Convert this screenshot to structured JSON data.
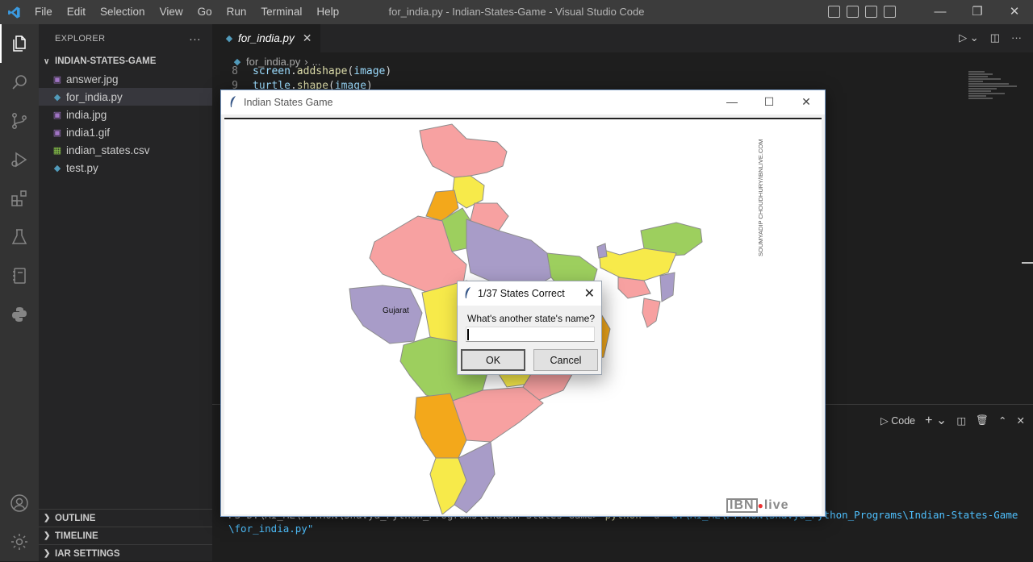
{
  "window": {
    "title": "for_india.py - Indian-States-Game - Visual Studio Code",
    "menu": [
      "File",
      "Edit",
      "Selection",
      "View",
      "Go",
      "Run",
      "Terminal",
      "Help"
    ]
  },
  "sidebar": {
    "header": "EXPLORER",
    "folder": "INDIAN-STATES-GAME",
    "files": [
      {
        "name": "answer.jpg",
        "icon": "image-file-icon",
        "color": "#a074c4"
      },
      {
        "name": "for_india.py",
        "icon": "python-file-icon",
        "color": "#519aba",
        "selected": true
      },
      {
        "name": "india.jpg",
        "icon": "image-file-icon",
        "color": "#a074c4"
      },
      {
        "name": "india1.gif",
        "icon": "image-file-icon",
        "color": "#a074c4"
      },
      {
        "name": "indian_states.csv",
        "icon": "csv-file-icon",
        "color": "#89c64a"
      },
      {
        "name": "test.py",
        "icon": "python-file-icon",
        "color": "#519aba"
      }
    ],
    "sections": [
      "OUTLINE",
      "TIMELINE",
      "IAR SETTINGS"
    ]
  },
  "editor": {
    "tab": "for_india.py",
    "breadcrumb_file": "for_india.py",
    "breadcrumb_rest": "...",
    "lines": [
      {
        "num": "8",
        "obj": "screen",
        "fn": "addshape",
        "arg": "image"
      },
      {
        "num": "9",
        "obj": "turtle",
        "fn": "shape",
        "arg": "image"
      }
    ]
  },
  "panel": {
    "profile_label": "Code",
    "terminal_prompt": "PS D:\\AI_ML\\PYTHON\\Shavya_Python_Programs\\Indian-States-Game>",
    "terminal_cmd": "python",
    "terminal_flag": "-u",
    "terminal_path": "\"d:\\AI_ML\\PYTHON\\Shavya_Python_Programs\\Indian-States-Game\\for_india.py\""
  },
  "game_window": {
    "title": "Indian States Game",
    "map_label": "Gujarat",
    "watermark": "SOUMYADIP CHOUDHURY/IBNLIVE.COM",
    "logo": "IBNLive"
  },
  "dialog": {
    "title": "1/37 States Correct",
    "prompt": "What's another state's name?",
    "input_value": "",
    "ok_label": "OK",
    "cancel_label": "Cancel"
  },
  "colors": {
    "map_pink": "#f7a1a1",
    "map_yellow": "#f7ea4a",
    "map_green": "#9dcf5e",
    "map_purple": "#a89cc8",
    "map_orange": "#f3a81b"
  }
}
